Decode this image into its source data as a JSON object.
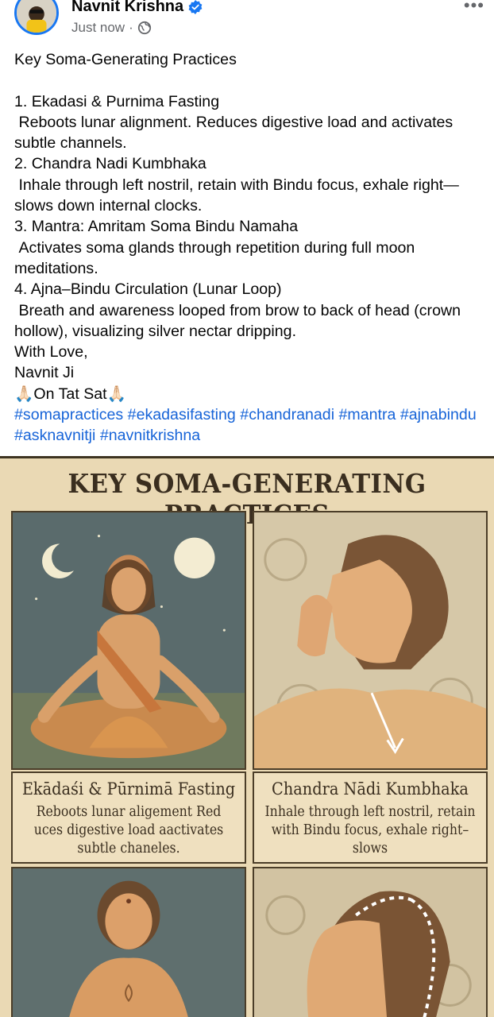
{
  "author": {
    "name": "Navnit Krishna",
    "time": "Just now",
    "separator": "·"
  },
  "header": {
    "more_label": "•••"
  },
  "post": {
    "title": "Key Soma-Generating Practices",
    "lines": [
      "1. Ekadasi & Purnima Fasting",
      " Reboots lunar alignment. Reduces digestive load and activates subtle channels.",
      "2. Chandra Nadi Kumbhaka",
      " Inhale through left nostril, retain with Bindu focus, exhale right—slows down internal clocks.",
      "3. Mantra: Amritam Soma Bindu Namaha",
      " Activates soma glands through repetition during full moon meditations.",
      "4. Ajna–Bindu Circulation (Lunar Loop)",
      " Breath and awareness looped from brow to back of head (crown hollow), visualizing silver nectar dripping.",
      "With Love,",
      "Navnit Ji",
      "🙏🏻On Tat Sat🙏🏻"
    ],
    "hashtags": [
      "#somapractices",
      "#ekadasifasting",
      "#chandranadi",
      "#mantra",
      "#ajnabindu",
      "#asknavnitji",
      "#navnitkrishna"
    ]
  },
  "image": {
    "title": "KEY SOMA-GENERATING PRACTICES",
    "panels": [
      {
        "title": "Ekādaśi & Pūrnimā Fasting",
        "body": "Reboots lunar aligement Red uces digestive load aactivates subtle chaneles."
      },
      {
        "title": "Chandra Nādi Kumbhaka",
        "body": "Inhale through left nostril, retain with Bindu focus, exhale right–slows"
      }
    ]
  },
  "colors": {
    "link": "#1764d8",
    "verified": "#1877f2",
    "poster_bg": "#ead9b4",
    "ink": "#3a2e1f"
  }
}
